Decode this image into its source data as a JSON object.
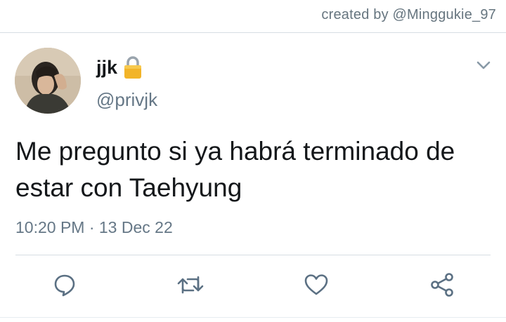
{
  "credit": {
    "text": "created by @Minggukie_97"
  },
  "tweet": {
    "display_name": "jjk",
    "handle": "@privjk",
    "text": "Me pregunto si ya habrá terminado de estar con Taehyung",
    "timestamp": "10:20 PM · 13 Dec 22"
  },
  "icons": {
    "lock": "lock-icon",
    "menu": "chevron-down-icon",
    "reply": "reply-icon",
    "retweet": "retweet-icon",
    "like": "heart-icon",
    "share": "share-icon"
  },
  "colors": {
    "text_primary": "#14171a",
    "text_secondary": "#657786",
    "icon": "#5b7083",
    "divider": "#d6dde3",
    "lock_gold": "#f2b429"
  }
}
